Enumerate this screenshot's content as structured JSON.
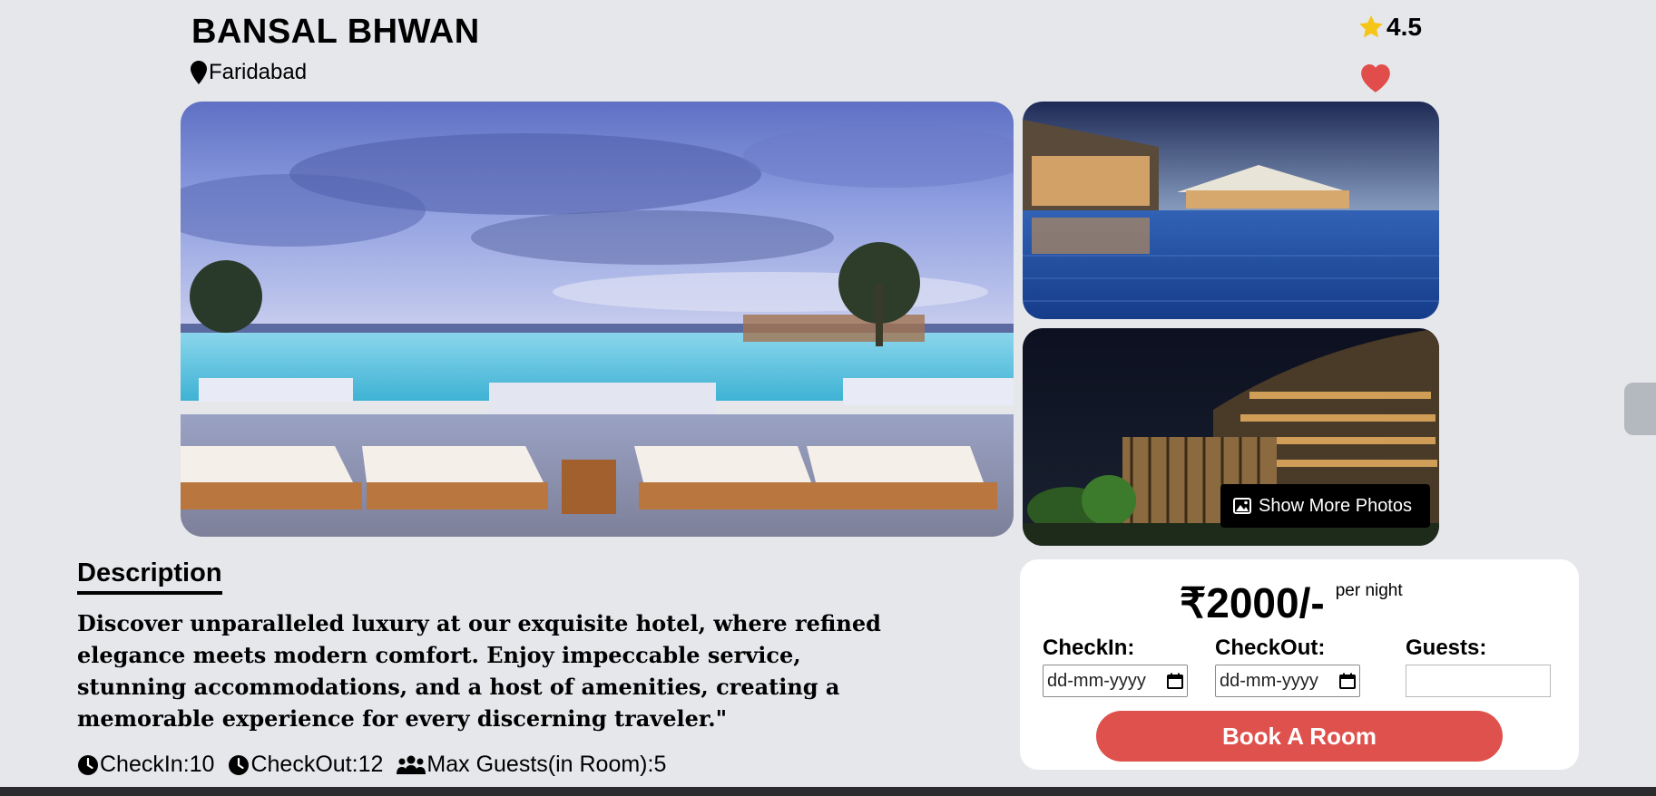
{
  "hotel": {
    "name": "BANSAL BHWAN",
    "location": "Faridabad",
    "rating": "4.5"
  },
  "gallery": {
    "show_more_label": "Show More Photos"
  },
  "description": {
    "heading": "Description",
    "text": "Discover unparalleled luxury at our exquisite hotel, where refined elegance meets modern comfort. Enjoy impeccable service, stunning accommodations, and a host of amenities, creating a memorable experience for every discerning traveler.\""
  },
  "meta": {
    "checkin": "CheckIn:10",
    "checkout": "CheckOut:12",
    "max_guests": "Max Guests(in Room):5"
  },
  "booking": {
    "price": "₹2000/-",
    "per_night": "per night",
    "checkin_label": "CheckIn:",
    "checkout_label": "CheckOut:",
    "guests_label": "Guests:",
    "date_placeholder": "dd-mm-yyyy",
    "guests_value": "",
    "book_label": "Book A Room"
  },
  "colors": {
    "page_bg": "#e6e7eb",
    "accent_red": "#df514c",
    "star": "#f5c518"
  },
  "icons": [
    "map-pin-icon",
    "star-icon",
    "heart-icon",
    "image-icon",
    "clock-icon",
    "users-icon",
    "calendar-icon"
  ]
}
